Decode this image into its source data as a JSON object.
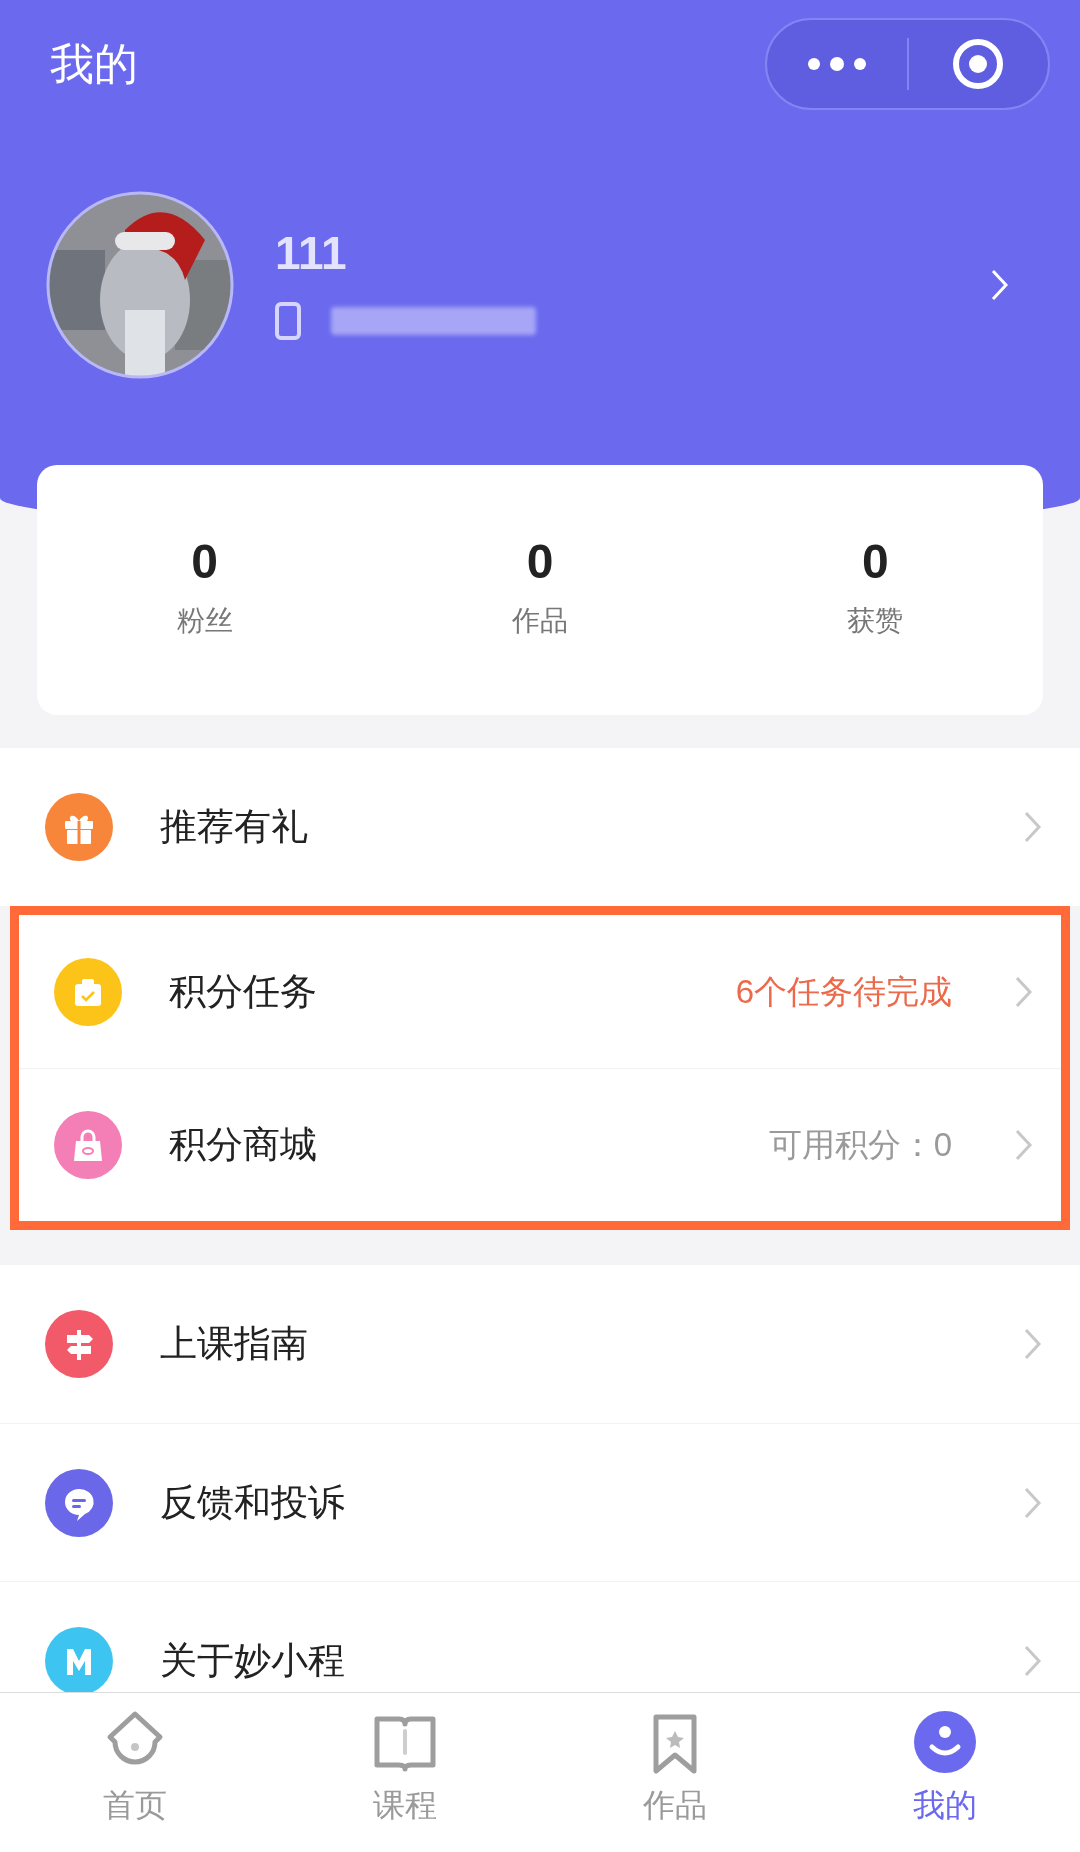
{
  "header": {
    "title": "我的"
  },
  "profile": {
    "name": "111"
  },
  "stats": [
    {
      "value": "0",
      "label": "粉丝"
    },
    {
      "value": "0",
      "label": "作品"
    },
    {
      "value": "0",
      "label": "获赞"
    }
  ],
  "menu_groups": [
    {
      "highlighted": false,
      "items": [
        {
          "kind": "gift",
          "color": "#f7853a",
          "label": "推荐有礼"
        }
      ]
    },
    {
      "highlighted": true,
      "items": [
        {
          "kind": "task",
          "color": "#fcc419",
          "label": "积分任务",
          "detail": {
            "text": "6个任务待完成",
            "kind": "alert"
          }
        },
        {
          "kind": "bag",
          "color": "#f47fb6",
          "label": "积分商城",
          "detail": {
            "text": "可用积分：0",
            "kind": "muted"
          }
        }
      ]
    },
    {
      "highlighted": false,
      "items": [
        {
          "kind": "sign",
          "color": "#f25a6a",
          "label": "上课指南"
        },
        {
          "kind": "chat",
          "color": "#6a67e8",
          "label": "反馈和投诉"
        },
        {
          "kind": "letter",
          "color": "#3ec4f0",
          "label": "关于妙小程"
        }
      ]
    }
  ],
  "tabs": [
    {
      "kind": "home",
      "label": "首页",
      "selected": false
    },
    {
      "kind": "book",
      "label": "课程",
      "selected": false
    },
    {
      "kind": "bookmark",
      "label": "作品",
      "selected": false
    },
    {
      "kind": "face",
      "label": "我的",
      "selected": true
    }
  ]
}
